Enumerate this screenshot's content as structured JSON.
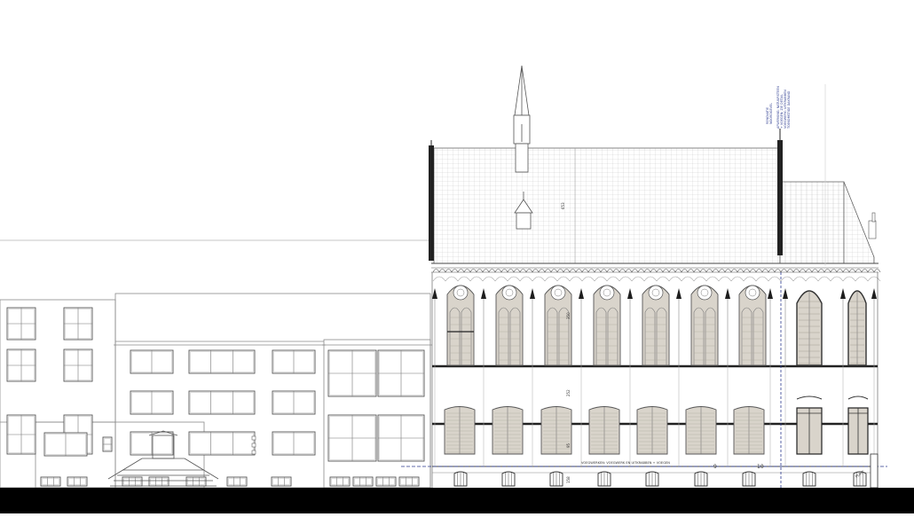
{
  "drawing": {
    "annotations": {
      "dim_roof": "653",
      "dim_upper": "350",
      "dim_mid": "252",
      "dim_low": "95",
      "dim_base": "158",
      "level_note": "VOEGWERKEN: VOEGWERK EN UITKRABBEN + VOEGEN",
      "level_9": "9",
      "level_10": "10",
      "plint": "PLINT"
    },
    "vertical_note_lines": [
      "TOEKOMSTIGE DAKRAND",
      "VOEGWERK: UITKRABBEN",
      "+ VOEGEN: ZIE DETAIL",
      "AFWERKING: NATUURSTEEN"
    ],
    "side_note_lines": [
      "NOORDGEVEL",
      "RENOVATIE"
    ],
    "colors": {
      "line": "#555555",
      "light_line": "#9a9a9a",
      "window_fill": "#d9d4cb",
      "dark": "#1e1e1e",
      "blue": "#2b3a8f"
    }
  }
}
